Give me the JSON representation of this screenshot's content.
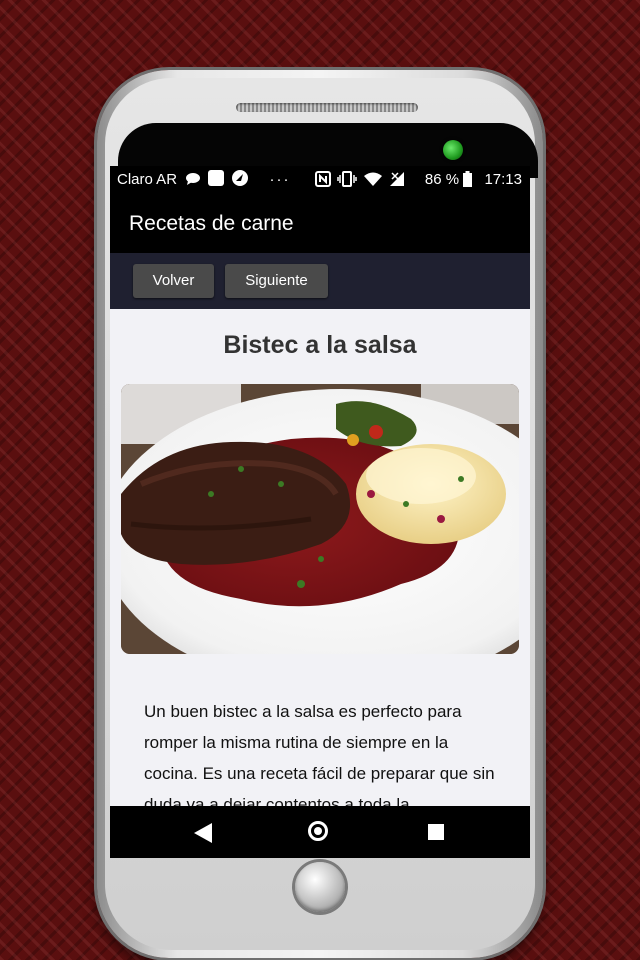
{
  "statusbar": {
    "carrier": "Claro AR",
    "icons_left": [
      "chat-bubble-icon",
      "app-square-icon",
      "navigation-icon"
    ],
    "more": "···",
    "battery": "86 %",
    "time": "17:13"
  },
  "appbar": {
    "title": "Recetas de carne"
  },
  "toolbar": {
    "back_label": "Volver",
    "next_label": "Siguiente"
  },
  "recipe": {
    "title": "Bistec a la salsa",
    "description": "Un buen bistec a la salsa es perfecto para romper la misma rutina de siempre en la cocina. Es una receta fácil de preparar que sin duda va a dejar contentos a toda la"
  },
  "colors": {
    "background": "#5a0f0f",
    "appbar": "#000000",
    "toolbar": "#1f2030",
    "button": "#4a4a4a",
    "content": "#f2f2f6"
  }
}
